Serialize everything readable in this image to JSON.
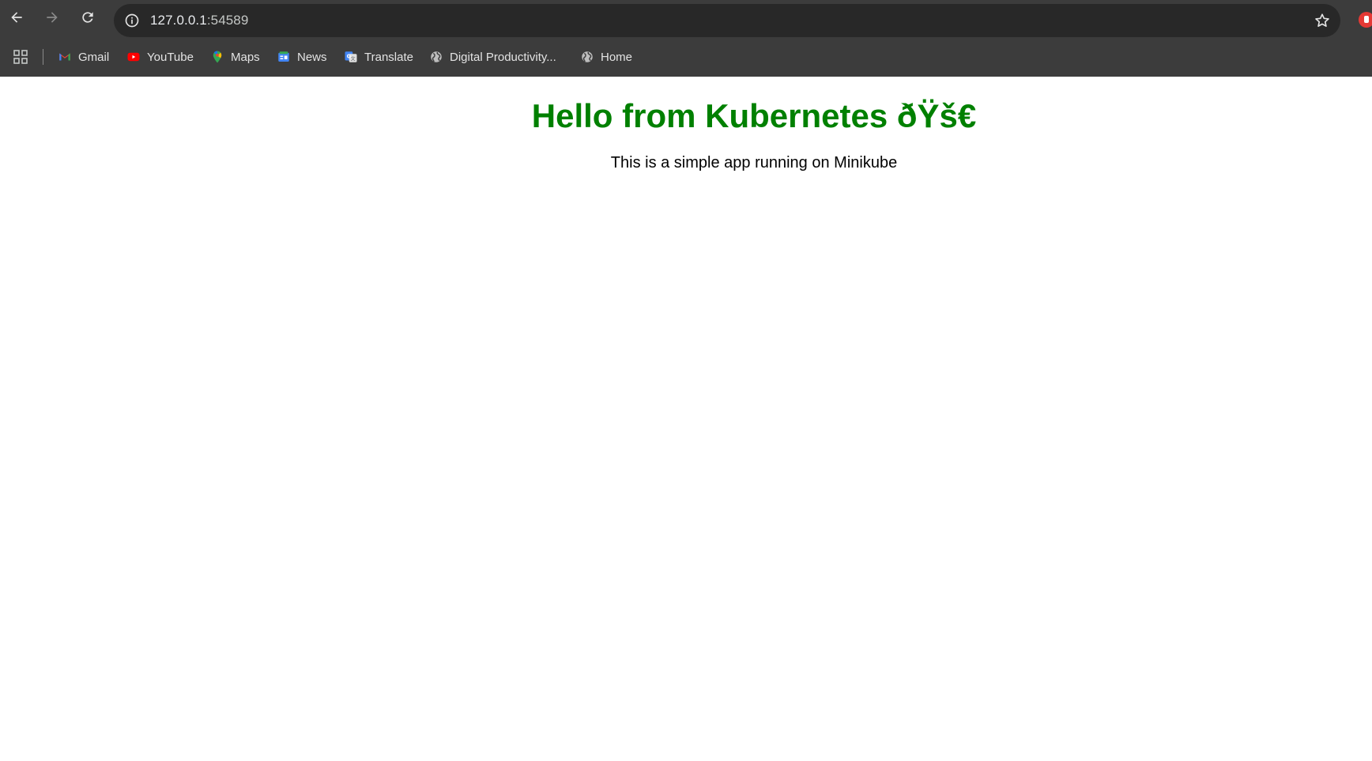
{
  "browser": {
    "url_host": "127.0.0.1",
    "url_port": ":54589"
  },
  "bookmarks": [
    {
      "label": "Gmail",
      "icon": "gmail-icon"
    },
    {
      "label": "YouTube",
      "icon": "youtube-icon"
    },
    {
      "label": "Maps",
      "icon": "maps-icon"
    },
    {
      "label": "News",
      "icon": "news-icon"
    },
    {
      "label": "Translate",
      "icon": "translate-icon"
    },
    {
      "label": "Digital Productivity...",
      "icon": "globe-icon"
    },
    {
      "label": "Home",
      "icon": "globe-icon"
    }
  ],
  "page": {
    "heading": "Hello from Kubernetes ðŸš€",
    "subtitle": "This is a simple app running on Minikube"
  },
  "colors": {
    "heading": "#008000",
    "chrome_bg": "#3c3c3c",
    "omnibox_bg": "#282828"
  }
}
